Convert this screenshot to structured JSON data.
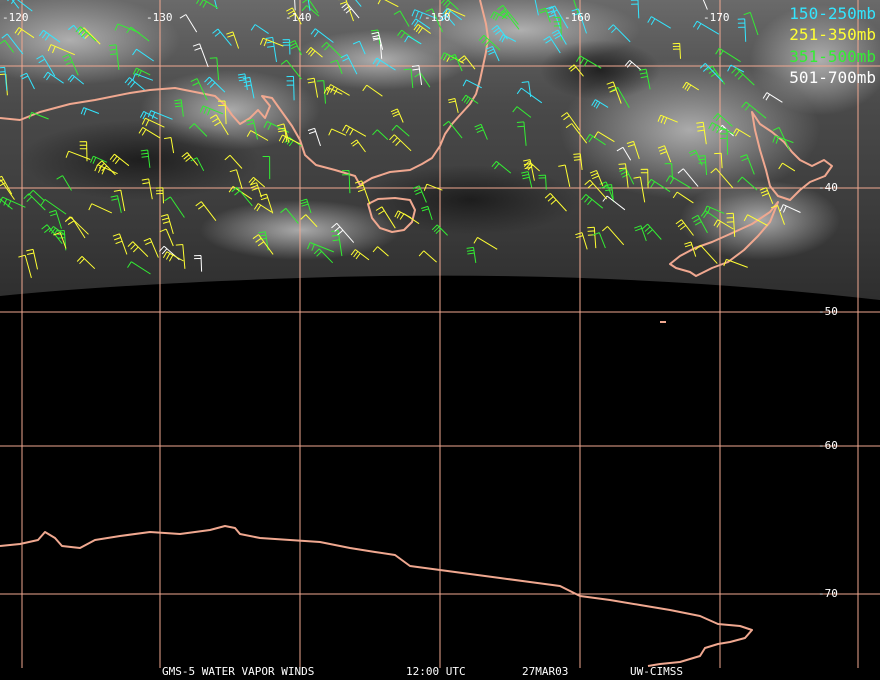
{
  "longitude_labels": [
    "-120",
    "-130",
    "-140",
    "-150",
    "-160",
    "-170"
  ],
  "latitude_labels": [
    "-40",
    "-50",
    "-60",
    "-70"
  ],
  "legend": [
    {
      "label": "150-250mb",
      "color": "#33e6ff"
    },
    {
      "label": "251-350mb",
      "color": "#ffff33"
    },
    {
      "label": "351-500mb",
      "color": "#33ee33"
    },
    {
      "label": "501-700mb",
      "color": "#ffffff"
    }
  ],
  "footer": {
    "product": "GMS-5 WATER VAPOR WINDS",
    "time": "12:00 UTC",
    "date": "27MAR03",
    "source": "UW-CIMSS"
  },
  "colors": {
    "coastline": "#f0a890",
    "grid": "#f0a890",
    "background": "#000000"
  },
  "icons": [
    "wind-barb-icon"
  ]
}
